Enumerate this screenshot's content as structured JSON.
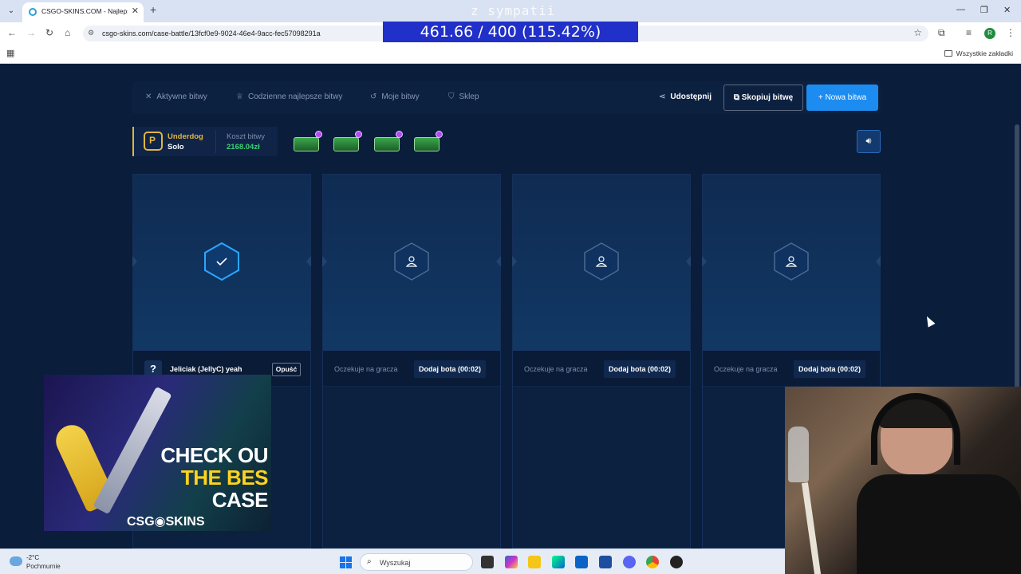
{
  "browser": {
    "tab_title": "CSGO-SKINS.COM - Najlepsze",
    "url": "csgo-skins.com/case-battle/13fcf0e9-9024-46e4-9acc-fec57098291a",
    "all_bookmarks": "Wszystkie zakładki",
    "profile_initial": "R"
  },
  "overlay": {
    "top_text": "z sympatii",
    "ratio": "461.66 / 400 (115.42%)"
  },
  "nav": {
    "items": [
      "Aktywne bitwy",
      "Codzienne najlepsze bitwy",
      "Moje bitwy",
      "Sklep"
    ],
    "share": "Udostępnij",
    "copy": "Skopiuj bitwę",
    "new_battle": "Nowa bitwa"
  },
  "battle": {
    "mode": "Underdog",
    "type": "Solo",
    "cost_label": "Koszt bitwy",
    "cost_value": "2168.04zł"
  },
  "slots": [
    {
      "player": "Jeliciak (JellyC) yeah",
      "leave": "Opuść",
      "avatar": "?"
    },
    {
      "waiting": "Oczekuje na gracza",
      "add_bot": "Dodaj bota (00:02)"
    },
    {
      "waiting": "Oczekuje na gracza",
      "add_bot": "Dodaj bota (00:02)"
    },
    {
      "waiting": "Oczekuje na gracza",
      "add_bot": "Dodaj bota (00:02)"
    }
  ],
  "ad": {
    "line1": "CHECK OU",
    "line2": "THE BES",
    "line3": "CASE",
    "brand": "CSG◉SKINS"
  },
  "taskbar": {
    "temp": "-2°C",
    "condition": "Pochmurnie",
    "search": "Wyszukaj"
  }
}
